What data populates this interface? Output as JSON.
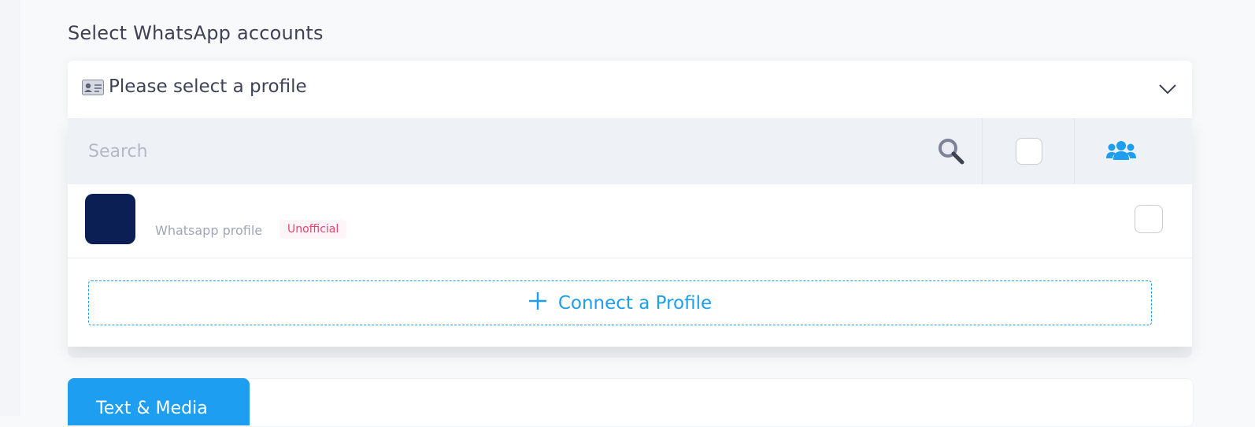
{
  "section": {
    "title": "Select WhatsApp accounts"
  },
  "profile_select": {
    "placeholder": "Please select a profile",
    "icons": {
      "leading": "id-card-icon",
      "trailing": "chevron-down-icon"
    }
  },
  "search": {
    "placeholder": "Search",
    "icon": "search-icon",
    "group_icon": "users-group-icon"
  },
  "profiles": [
    {
      "type_label": "Whatsapp profile",
      "badge": "Unofficial"
    }
  ],
  "connect_button": {
    "label": "Connect a Profile",
    "icon": "plus-icon"
  },
  "tabs": [
    {
      "label": "Text & Media"
    }
  ],
  "colors": {
    "accent": "#1e9ef1",
    "badge_text": "#f1416c",
    "badge_bg": "#fff5f8",
    "avatar": "#0b1f55",
    "search_bg": "#eef1f5"
  }
}
